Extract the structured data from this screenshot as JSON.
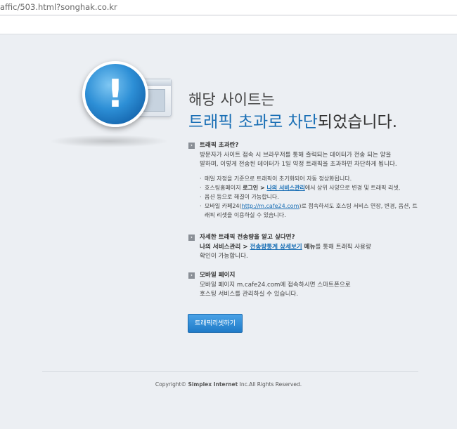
{
  "browser": {
    "url": "affic/503.html?songhak.co.kr"
  },
  "heading": {
    "line1": "해당 사이트는",
    "line2_blue": "트래픽 초과로 차단",
    "line2_rest": "되었습니다."
  },
  "section_traffic": {
    "title": "트래픽 초과란?",
    "body_line1": "방문자가 사이트 접속 시 브라우저를 통해 출력되는 데이터가 전송 되는 양을",
    "body_line2": "말하며, 이렇게 전송된 데이터가 1일 약정 트래픽을 초과하면 차단하게 됩니다.",
    "bullet1": "매일 자정을 기준으로 트래픽이 초기화되어 자동 정상화됩니다.",
    "bullet2_pre": "호스팅홈페이지 ",
    "bullet2_bold": "로그인",
    "bullet2_sep": " > ",
    "bullet2_link": "나의 서비스관리",
    "bullet2_post": "에서 상위 사양으로 변경 및 트래픽 리셋,",
    "bullet2_line2": "옵션 등으로 해결이 가능합니다.",
    "bullet3_pre": "모바일 카페24(",
    "bullet3_link": "http://m.cafe24.com",
    "bullet3_post": ")로 접속하셔도 호스팅 서비스 연장, 변경, 옵션, 트",
    "bullet3_line2": "래픽 리셋을 이용하실 수 있습니다."
  },
  "section_detail": {
    "title": "자세한 트래픽 전송량을 알고 싶다면?",
    "line1_bold": "나의 서비스관리",
    "line1_sep": " > ",
    "line1_link": "전송량통계 상세보기",
    "line1_bold2": " 메뉴",
    "line1_post": "를 통해 트래픽 사용량",
    "line2": "확인이 가능합니다."
  },
  "section_mobile": {
    "title": "모바일 페이지",
    "line1": "모바일 페이지 m.cafe24.com에 접속하시면 스마트폰으로",
    "line2": "호스팅 서비스를 관리하실 수 있습니다."
  },
  "button": {
    "label": "트래픽리셋하기"
  },
  "footer": {
    "pre": "Copyright© ",
    "bold": "Simplex Internet",
    "post": " Inc.All Rights Reserved."
  },
  "colors": {
    "accent": "#1a6fb5",
    "button": "#2a88d4",
    "background": "#eceff3"
  },
  "icons": [
    "alert-exclamation-icon",
    "browser-window-icon",
    "arrow-bullet-icon"
  ]
}
